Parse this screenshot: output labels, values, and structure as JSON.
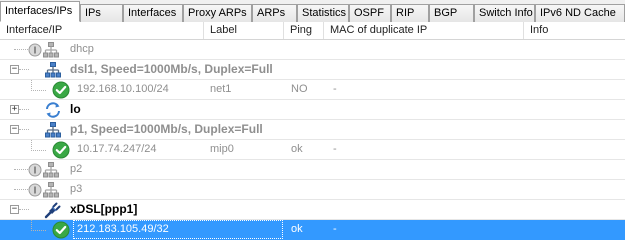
{
  "tabs": [
    {
      "label": "Interfaces/IPs",
      "active": true
    },
    {
      "label": "IPs",
      "active": false
    },
    {
      "label": "Interfaces",
      "active": false
    },
    {
      "label": "Proxy ARPs",
      "active": false
    },
    {
      "label": "ARPs",
      "active": false
    },
    {
      "label": "Statistics",
      "active": false
    },
    {
      "label": "OSPF",
      "active": false
    },
    {
      "label": "RIP",
      "active": false
    },
    {
      "label": "BGP",
      "active": false
    },
    {
      "label": "Switch Info",
      "active": false
    },
    {
      "label": "IPv6 ND Cache",
      "active": false
    }
  ],
  "columns": {
    "interface_ip": "Interface/IP",
    "label": "Label",
    "ping": "Ping",
    "mac_dup": "MAC of duplicate IP",
    "info": "Info"
  },
  "rows": [
    {
      "kind": "interface",
      "name": "dhcp",
      "icon": "network-disabled-icon",
      "status": "disabled",
      "expander": "none"
    },
    {
      "kind": "interface",
      "name": "dsl1, Speed=1000Mb/s, Duplex=Full",
      "icon": "network-interface-icon",
      "status": "inactive",
      "expander": "minus"
    },
    {
      "kind": "ip",
      "ip": "192.168.10.100/24",
      "label": "net1",
      "ping": "NO",
      "mac": "-",
      "icon": "check-icon"
    },
    {
      "kind": "interface",
      "name": "lo",
      "icon": "loopback-icon",
      "status": "active",
      "expander": "plus"
    },
    {
      "kind": "interface",
      "name": "p1, Speed=1000Mb/s, Duplex=Full",
      "icon": "network-interface-icon",
      "status": "inactive",
      "expander": "minus"
    },
    {
      "kind": "ip",
      "ip": "10.17.74.247/24",
      "label": "mip0",
      "ping": "ok",
      "mac": "-",
      "icon": "check-icon"
    },
    {
      "kind": "interface",
      "name": "p2",
      "icon": "network-disabled-icon",
      "status": "disabled",
      "expander": "none"
    },
    {
      "kind": "interface",
      "name": "p3",
      "icon": "network-disabled-icon",
      "status": "disabled",
      "expander": "none"
    },
    {
      "kind": "interface",
      "name": "xDSL[ppp1]",
      "icon": "plug-icon",
      "status": "active",
      "expander": "minus"
    },
    {
      "kind": "ip",
      "ip": "212.183.105.49/32",
      "label": "",
      "ping": "ok",
      "mac": "-",
      "icon": "check-icon",
      "selected": true
    }
  ],
  "colors": {
    "selection": "#3399ff",
    "check_green": "#3aa845",
    "disabled_gray": "#8f8f8f",
    "network_blue": "#2c5f9e"
  }
}
